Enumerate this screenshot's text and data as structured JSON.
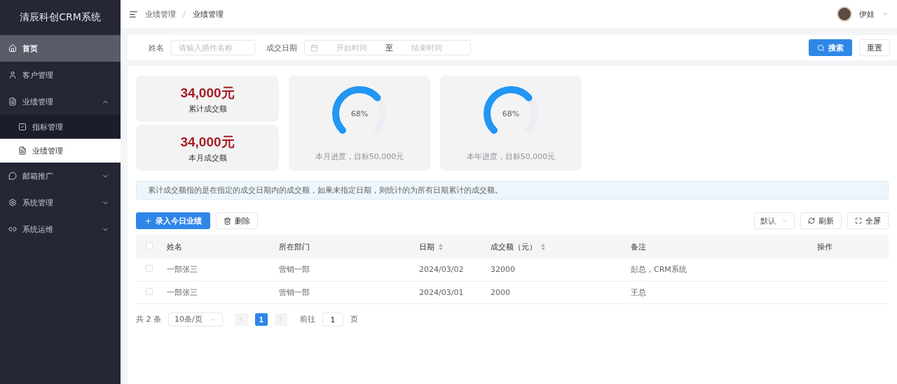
{
  "sidebar": {
    "title": "清辰科创CRM系统",
    "items": [
      {
        "kind": "link",
        "label": "首页",
        "selected": false,
        "hovered": true
      },
      {
        "kind": "link",
        "label": "客户管理",
        "selected": false,
        "hovered": false
      },
      {
        "kind": "group",
        "label": "业绩管理",
        "selected": false,
        "hovered": false,
        "expanded": true,
        "children": [
          {
            "label": "指标管理",
            "selected": false
          },
          {
            "label": "业绩管理",
            "selected": true
          }
        ]
      },
      {
        "kind": "group",
        "label": "邮箱推广",
        "selected": false,
        "hovered": false,
        "expanded": false
      },
      {
        "kind": "group",
        "label": "系统管理",
        "selected": false,
        "hovered": false,
        "expanded": false
      },
      {
        "kind": "group",
        "label": "系统运维",
        "selected": false,
        "hovered": false,
        "expanded": false
      }
    ]
  },
  "header": {
    "breadcrumb": [
      "业绩管理",
      "业绩管理"
    ],
    "breadcrumb_separator": "/",
    "user": "伊娃"
  },
  "filters": {
    "name_label": "姓名",
    "name_placeholder": "请输入插件名称",
    "date_label": "成交日期",
    "start_placeholder": "开始时间",
    "range_separator": "至",
    "end_placeholder": "结束时间",
    "search_button": "搜索",
    "reset_button": "重置"
  },
  "stats": [
    {
      "value": "34,000元",
      "label": "累计成交额"
    },
    {
      "value": "34,000元",
      "label": "本月成交额"
    }
  ],
  "gauges": [
    {
      "reading": "68%",
      "caption": "本月进度，目标50,000元"
    },
    {
      "reading": "68%",
      "caption": "本年进度，目标50,000元"
    }
  ],
  "notice": "累计成交额指的是在指定的成交日期内的成交额，如果未指定日期，则统计的为所有日期累计的成交额。",
  "toolbar": {
    "add_button": "录入今日业绩",
    "delete_button": "删除",
    "size_select": "默认",
    "refresh_button": "刷新",
    "fullscreen_button": "全屏"
  },
  "table": {
    "columns": [
      {
        "kind": "plain",
        "label": "姓名"
      },
      {
        "kind": "plain",
        "label": "所在部门"
      },
      {
        "kind": "sortable",
        "label": "日期"
      },
      {
        "kind": "sortable",
        "label": "成交额（元）"
      },
      {
        "kind": "plain",
        "label": "备注"
      },
      {
        "kind": "plain",
        "label": "操作"
      }
    ],
    "header_checked": false,
    "rows": [
      {
        "checked": false,
        "cells": [
          "一部张三",
          "营销一部",
          "2024/03/02",
          "32000",
          "彭总，CRM系统",
          ""
        ]
      },
      {
        "checked": false,
        "cells": [
          "一部张三",
          "营销一部",
          "2024/03/01",
          "2000",
          "王总",
          ""
        ]
      }
    ]
  },
  "pagination": {
    "total": "共 2 条",
    "page_size": "10条/页",
    "pages": [
      {
        "label": "1",
        "selected": true
      }
    ],
    "goto_label": "前往",
    "goto_value": "1",
    "page_suffix": "页"
  }
}
